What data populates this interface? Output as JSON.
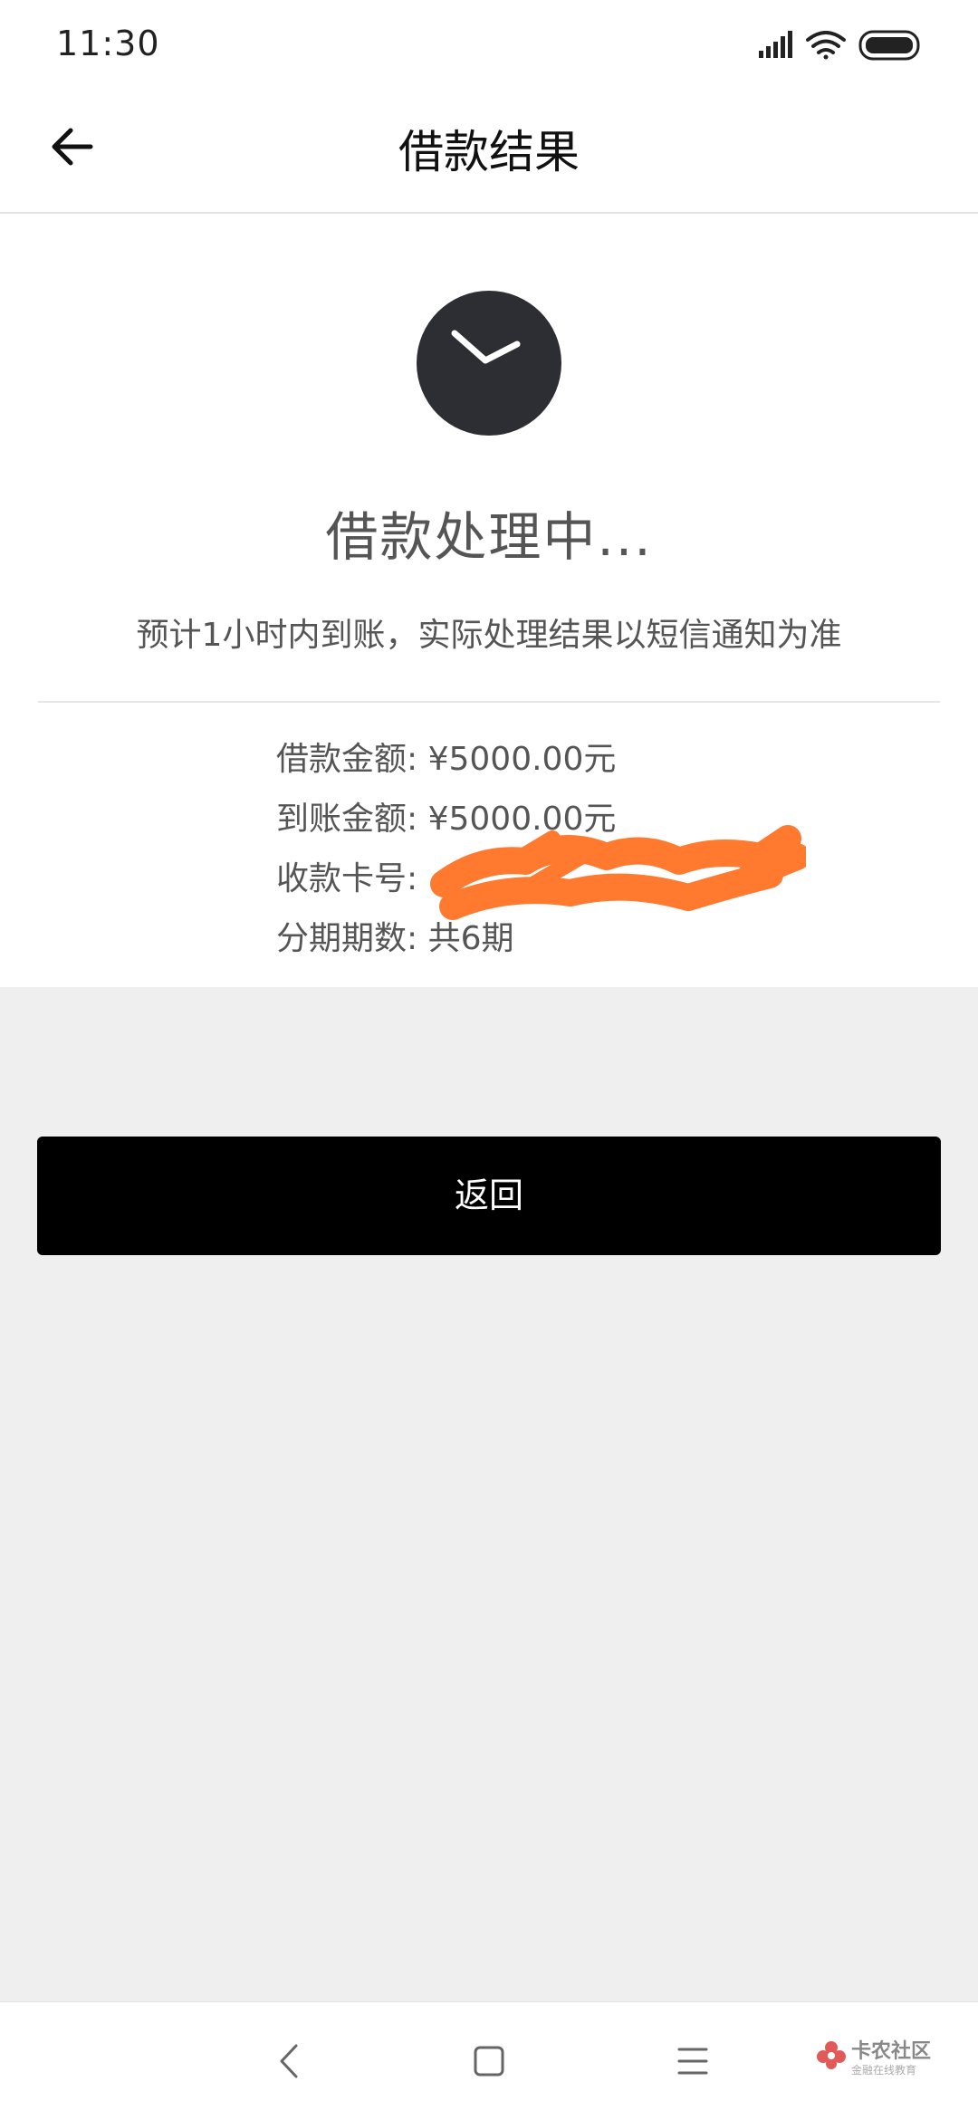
{
  "status_bar": {
    "time": "11:30"
  },
  "header": {
    "title": "借款结果"
  },
  "result": {
    "title": "借款处理中...",
    "subtitle": "预计1小时内到账，实际处理结果以短信通知为准"
  },
  "details": [
    {
      "label": "借款金额: ",
      "value": "¥5000.00元"
    },
    {
      "label": "到账金额: ",
      "value": "¥5000.00元"
    },
    {
      "label": "收款卡号: ",
      "value": ""
    },
    {
      "label": "分期期数: ",
      "value": "共6期"
    }
  ],
  "actions": {
    "return_label": "返回"
  },
  "watermark": {
    "main": "卡农社区",
    "sub": "金融在线教育"
  },
  "colors": {
    "button": "#000000",
    "background": "#efefef",
    "scribble": "#ff7a2e",
    "clock": "#2d2e33"
  }
}
